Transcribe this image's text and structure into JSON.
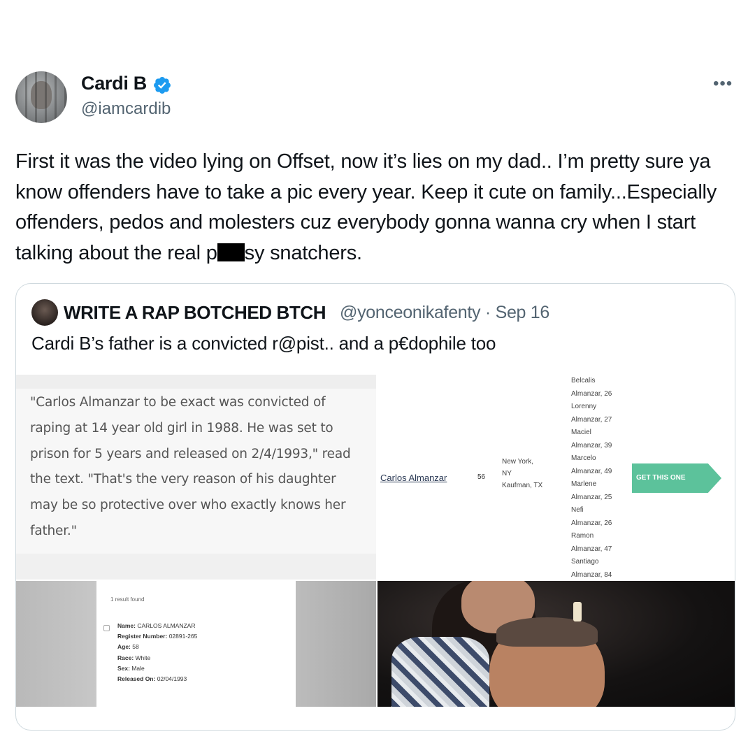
{
  "tweet": {
    "display_name": "Cardi B",
    "verified": true,
    "handle": "@iamcardib",
    "more_label": "•••",
    "text_part1": "First it was the video lying on Offset, now it’s lies on my dad.. I’m pretty sure ya know offenders have to take a pic every year. Keep it cute on family...Especially offenders, pedos and molesters cuz everybody gonna wanna cry when I start talking about the real p",
    "text_part2": "sy snatchers."
  },
  "quoted_tweet": {
    "display_name": "WRITE A RAP BOTCHED BTCH",
    "handle_date": "@yonceonikafenty · Sep 16",
    "text": "Cardi B’s father is a convicted r@pist.. and a p€dophile too",
    "media": {
      "article_quote": "\"Carlos Almanzar to be exact was convicted of raping at 14 year old girl in 1988. He was set to prison for 5 years and released on 2/4/1993,\" read the text. \"That's the very reason of his daughter may be so protective over who exactly knows her father.\"",
      "record": {
        "name": "Carlos Almanzar",
        "age": "56",
        "locations": [
          "New York,",
          "NY",
          "Kaufman, TX"
        ],
        "relatives": [
          "Belcalis",
          "Almanzar, 26",
          "Lorenny",
          "Almanzar, 27",
          "Maciel",
          "Almanzar, 39",
          "Marcelo",
          "Almanzar, 49",
          "Marlene",
          "Almanzar, 25",
          "Nefi",
          "Almanzar, 26",
          "Ramon",
          "Almanzar, 47",
          "Santiago",
          "Almanzar, 84"
        ],
        "button_label": "GET THIS ONE"
      },
      "federal_record": {
        "found_label": "1 result found",
        "name_label": "Name:",
        "name_value": "CARLOS ALMANZAR",
        "register_label": "Register Number:",
        "register_value": "02891-265",
        "age_label": "Age:",
        "age_value": "58",
        "race_label": "Race:",
        "race_value": "White",
        "sex_label": "Sex:",
        "sex_value": "Male",
        "released_label": "Released On:",
        "released_value": "02/04/1993"
      }
    }
  },
  "colors": {
    "verified_blue": "#1d9bf0",
    "secondary_text": "#536471",
    "border": "#cfd9de",
    "button_green": "#5cc29b"
  }
}
